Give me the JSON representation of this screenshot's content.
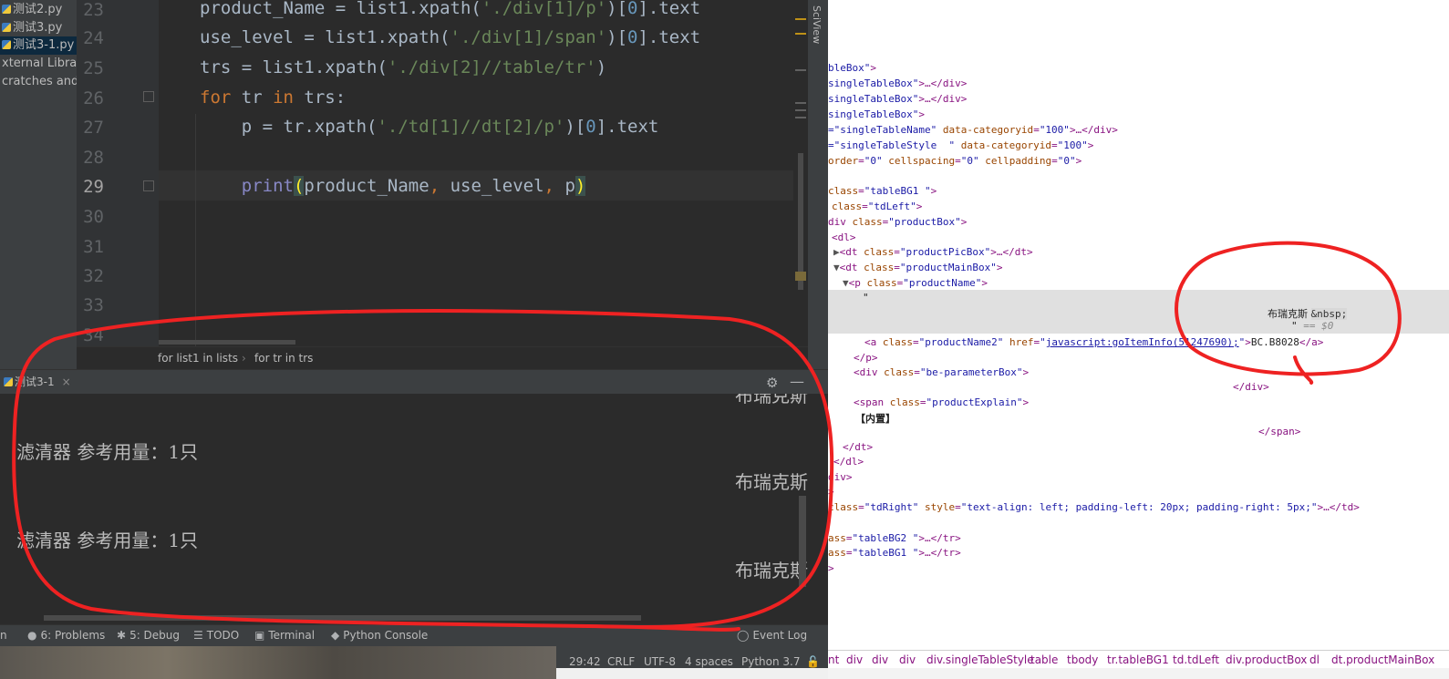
{
  "project": {
    "items": [
      {
        "label": "测试2.py",
        "py": true,
        "selected": false
      },
      {
        "label": "测试3.py",
        "py": true,
        "selected": false
      },
      {
        "label": "测试3-1.py",
        "py": true,
        "selected": true
      },
      {
        "label": "xternal Librarie",
        "py": false,
        "selected": false
      },
      {
        "label": "cratches and C",
        "py": false,
        "selected": false
      }
    ]
  },
  "editor": {
    "line_numbers": [
      "23",
      "24",
      "25",
      "26",
      "27",
      "28",
      "29",
      "30",
      "31",
      "32",
      "33",
      "34"
    ],
    "current_line": "29"
  },
  "breadcrumb": {
    "items": [
      "for list1 in lists",
      "for tr in trs"
    ],
    "sep": "›"
  },
  "sideview_label": "SciView",
  "run": {
    "tab_label": "测试3-1",
    "close": "×"
  },
  "console": {
    "lines": [
      {
        "text": "布瑞克斯",
        "right": true
      },
      {
        "text": "滤清器 参考用量：1只",
        "right": false
      },
      {
        "text": "布瑞克斯",
        "right": true
      },
      {
        "text": "滤清器 参考用量：1只",
        "right": false
      },
      {
        "text": "布瑞克斯",
        "right": true
      }
    ]
  },
  "tooltabs": {
    "items": [
      {
        "icon": "",
        "label": "n"
      },
      {
        "icon": "●",
        "label": "6: Problems"
      },
      {
        "icon": "✱",
        "label": "5: Debug"
      },
      {
        "icon": "☰",
        "label": "TODO"
      },
      {
        "icon": "▣",
        "label": "Terminal"
      },
      {
        "icon": "◆",
        "label": "Python Console"
      },
      {
        "icon": "◯",
        "label": "Event Log"
      }
    ]
  },
  "statusbar": {
    "position": "29:42",
    "line_sep": "CRLF",
    "encoding": "UTF-8",
    "indent": "4 spaces",
    "interpreter": "Python 3.7"
  },
  "devtools": {
    "crumbs": [
      "nt",
      "div",
      "div",
      "div",
      "div.singleTableStyle",
      "table",
      "tbody",
      "tr.tableBG1",
      "td.tdLeft",
      "div.productBox",
      "dl",
      "dt.productMainBox"
    ]
  },
  "colors": {
    "annotation": "#ee2222",
    "ide_bg": "#2b2b2b",
    "keyword": "#cc7832",
    "string": "#6a8759"
  }
}
